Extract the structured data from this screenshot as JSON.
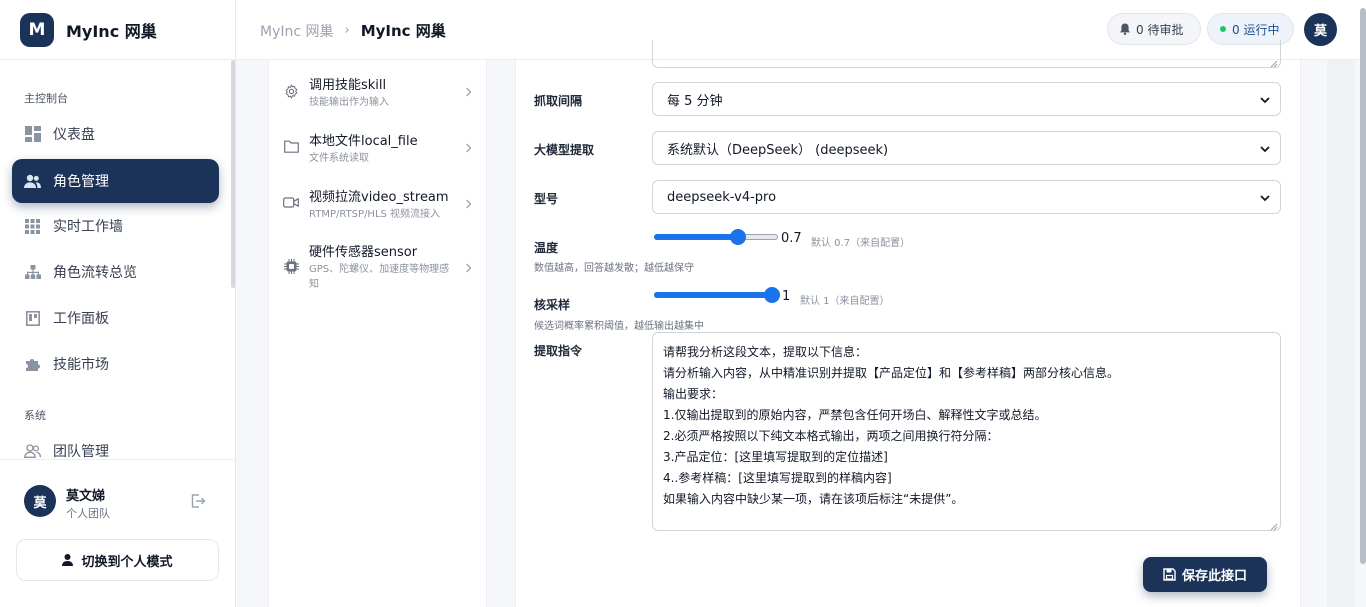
{
  "brand": {
    "logo_letter": "M",
    "name": "MyInc 网巢"
  },
  "sidebar": {
    "sections": [
      {
        "label": "主控制台",
        "items": [
          {
            "label": "仪表盘",
            "icon": "dashboard-icon",
            "active": false
          },
          {
            "label": "角色管理",
            "icon": "users-icon",
            "active": true
          },
          {
            "label": "实时工作墙",
            "icon": "grid-icon",
            "active": false
          },
          {
            "label": "角色流转总览",
            "icon": "hierarchy-icon",
            "active": false
          },
          {
            "label": "工作面板",
            "icon": "board-icon",
            "active": false
          },
          {
            "label": "技能市场",
            "icon": "puzzle-icon",
            "active": false
          }
        ]
      },
      {
        "label": "系统",
        "items": [
          {
            "label": "团队管理",
            "icon": "team-icon",
            "active": false
          }
        ]
      }
    ],
    "user": {
      "avatar": "莫",
      "name": "莫文娣",
      "team": "个人团队"
    },
    "switch_button": "切换到个人模式"
  },
  "header": {
    "breadcrumb": [
      "MyInc 网巢",
      "MyInc 网巢"
    ],
    "breadcrumb_sep": "›",
    "approval_pill": "0 待审批",
    "running_pill": "0 运行中",
    "avatar": "莫"
  },
  "tools": [
    {
      "title": "调用技能skill",
      "desc": "技能输出作为输入",
      "icon": "gear-icon"
    },
    {
      "title": "本地文件local_file",
      "desc": "文件系统读取",
      "icon": "folder-icon"
    },
    {
      "title": "视频拉流video_stream",
      "desc": "RTMP/RTSP/HLS 视频流接入",
      "icon": "video-icon"
    },
    {
      "title": "硬件传感器sensor",
      "desc": "GPS、陀螺仪、加速度等物理感知",
      "icon": "chip-icon"
    }
  ],
  "form": {
    "interval": {
      "label": "抓取间隔",
      "value": "每 5 分钟"
    },
    "llm": {
      "label": "大模型提取",
      "value": "系统默认（DeepSeek） (deepseek)"
    },
    "model": {
      "label": "型号",
      "value": "deepseek-v4-pro"
    },
    "temperature": {
      "label": "温度",
      "help": "数值越高，回答越发散；越低越保守",
      "value": "0.7",
      "fraction": 0.7,
      "default": "默认 0.7（来自配置）"
    },
    "top_p": {
      "label": "核采样",
      "help": "候选词概率累积阈值，越低输出越集中",
      "value": "1",
      "fraction": 1.0,
      "default": "默认 1（来自配置）"
    },
    "prompt": {
      "label": "提取指令",
      "lines": [
        "请帮我分析这段文本，提取以下信息：",
        "请分析输入内容，从中精准识别并提取【产品定位】和【参考样稿】两部分核心信息。",
        "输出要求：",
        "1.仅输出提取到的原始内容，严禁包含任何开场白、解释性文字或总结。",
        "2.必须严格按照以下纯文本格式输出，两项之间用换行符分隔：",
        "3.产品定位：[这里填写提取到的定位描述]",
        "4..参考样稿：[这里填写提取到的样稿内容]",
        "如果输入内容中缺少某一项，请在该项后标注“未提供”。"
      ]
    },
    "save_button": "保存此接口"
  },
  "colors": {
    "primary": "#1b3358",
    "slider": "#1a73e8",
    "running_dot": "#22c55e"
  }
}
